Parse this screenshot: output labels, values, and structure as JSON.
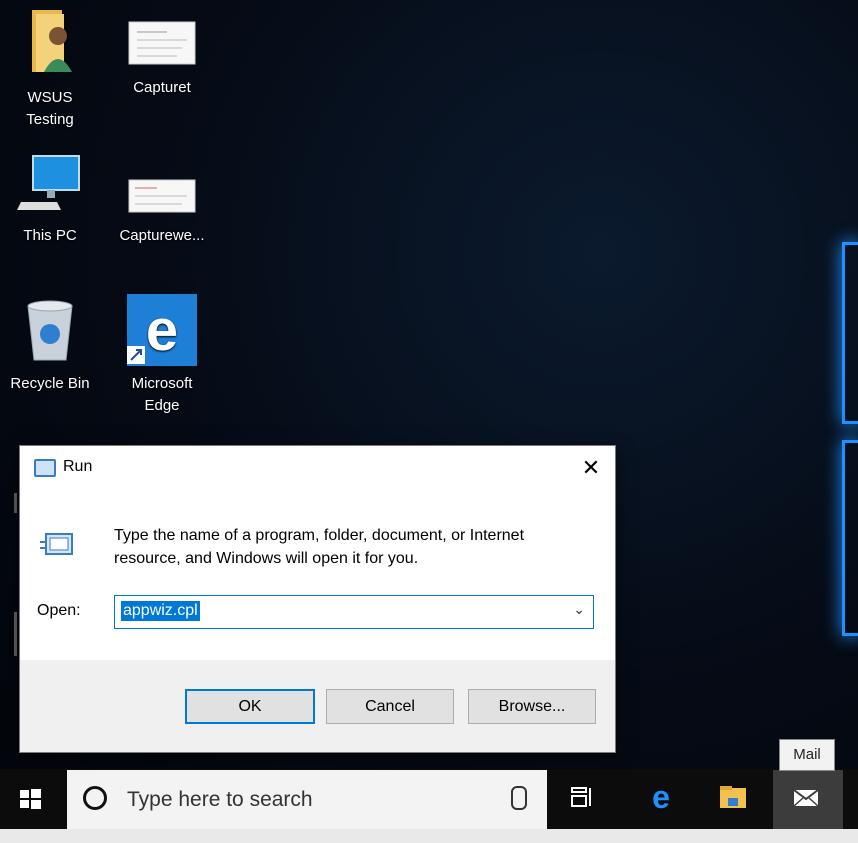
{
  "desktop": {
    "icons": [
      {
        "label_line1": "WSUS",
        "label_line2": "Testing"
      },
      {
        "label_line1": "Capturet",
        "label_line2": ""
      },
      {
        "label_line1": "This PC",
        "label_line2": ""
      },
      {
        "label_line1": "Capturewe...",
        "label_line2": ""
      },
      {
        "label_line1": "Recycle Bin",
        "label_line2": ""
      },
      {
        "label_line1": "Microsoft",
        "label_line2": "Edge"
      }
    ]
  },
  "run_dialog": {
    "title": "Run",
    "close_glyph": "✕",
    "description": "Type the name of a program, folder, document, or Internet resource, and Windows will open it for you.",
    "open_label": "Open:",
    "open_value": "appwiz.cpl",
    "buttons": {
      "ok": "OK",
      "cancel": "Cancel",
      "browse": "Browse..."
    }
  },
  "taskbar": {
    "search_placeholder": "Type here to search",
    "tooltip": "Mail"
  },
  "colors": {
    "accent": "#0078d7",
    "edge_blue": "#1e90ff"
  }
}
